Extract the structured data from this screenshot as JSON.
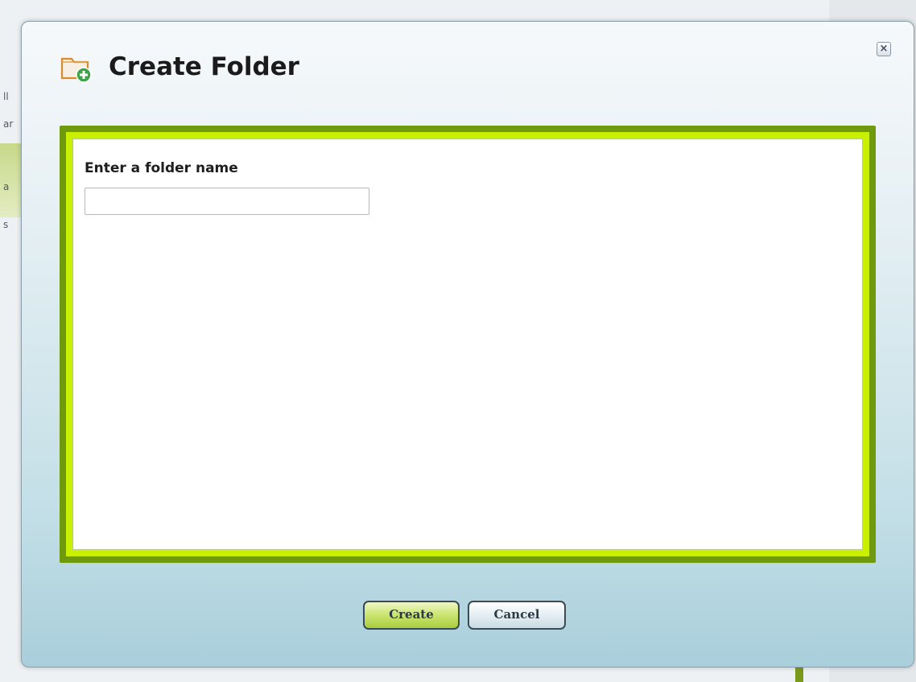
{
  "dialog": {
    "title": "Create Folder",
    "close_label": "×",
    "field_label": "Enter a folder name",
    "input_value": "",
    "input_placeholder": "",
    "create_label": "Create",
    "cancel_label": "Cancel",
    "icon": "folder-add-icon"
  },
  "background": {
    "left_fragments": [
      "ll",
      "ar",
      "a",
      "s"
    ]
  },
  "colors": {
    "frame_dark": "#6f9a0e",
    "frame_bright": "#c9f000",
    "create_button": "#cde676",
    "dialog_bottom": "#a9cfdb"
  }
}
